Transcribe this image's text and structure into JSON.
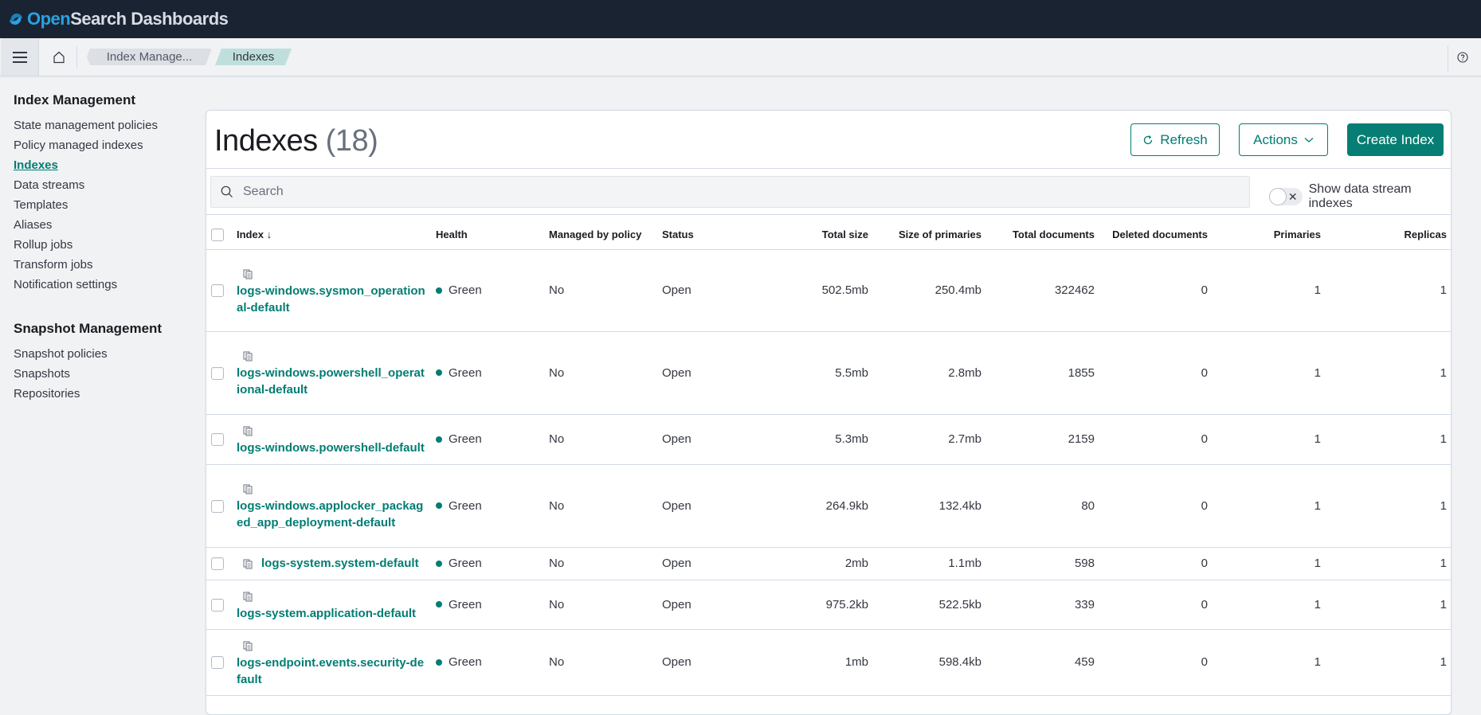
{
  "app": {
    "brand_open": "Open",
    "brand_rest": "Search Dashboards"
  },
  "breadcrumbs": [
    {
      "label": "Index Manage..."
    },
    {
      "label": "Indexes"
    }
  ],
  "sidebar": {
    "sections": [
      {
        "title": "Index Management",
        "items": [
          {
            "label": "State management policies",
            "active": false
          },
          {
            "label": "Policy managed indexes",
            "active": false
          },
          {
            "label": "Indexes",
            "active": true
          },
          {
            "label": "Data streams",
            "active": false
          },
          {
            "label": "Templates",
            "active": false
          },
          {
            "label": "Aliases",
            "active": false
          },
          {
            "label": "Rollup jobs",
            "active": false
          },
          {
            "label": "Transform jobs",
            "active": false
          },
          {
            "label": "Notification settings",
            "active": false
          }
        ]
      },
      {
        "title": "Snapshot Management",
        "items": [
          {
            "label": "Snapshot policies",
            "active": false
          },
          {
            "label": "Snapshots",
            "active": false
          },
          {
            "label": "Repositories",
            "active": false
          }
        ]
      }
    ]
  },
  "main": {
    "title": "Indexes",
    "count": "(18)",
    "buttons": {
      "refresh": "Refresh",
      "actions": "Actions",
      "create": "Create Index"
    },
    "search": {
      "placeholder": "Search",
      "value": ""
    },
    "toggle": {
      "label": "Show data stream indexes",
      "on": false
    },
    "table": {
      "sorted_by": "Index",
      "sort_direction": "descending",
      "columns": [
        "Index",
        "Health",
        "Managed by policy",
        "Status",
        "Total size",
        "Size of primaries",
        "Total documents",
        "Deleted documents",
        "Primaries",
        "Replicas"
      ],
      "rows": [
        {
          "index": "logs-windows.sysmon_operational-default",
          "health": "Green",
          "managed": "No",
          "status": "Open",
          "total_size": "502.5mb",
          "primary_size": "250.4mb",
          "total_docs": "322462",
          "deleted_docs": "0",
          "primaries": "1",
          "replicas": "1"
        },
        {
          "index": "logs-windows.powershell_operational-default",
          "health": "Green",
          "managed": "No",
          "status": "Open",
          "total_size": "5.5mb",
          "primary_size": "2.8mb",
          "total_docs": "1855",
          "deleted_docs": "0",
          "primaries": "1",
          "replicas": "1"
        },
        {
          "index": "logs-windows.powershell-default",
          "health": "Green",
          "managed": "No",
          "status": "Open",
          "total_size": "5.3mb",
          "primary_size": "2.7mb",
          "total_docs": "2159",
          "deleted_docs": "0",
          "primaries": "1",
          "replicas": "1"
        },
        {
          "index": "logs-windows.applocker_packaged_app_deployment-default",
          "health": "Green",
          "managed": "No",
          "status": "Open",
          "total_size": "264.9kb",
          "primary_size": "132.4kb",
          "total_docs": "80",
          "deleted_docs": "0",
          "primaries": "1",
          "replicas": "1"
        },
        {
          "index": "logs-system.system-default",
          "health": "Green",
          "managed": "No",
          "status": "Open",
          "total_size": "2mb",
          "primary_size": "1.1mb",
          "total_docs": "598",
          "deleted_docs": "0",
          "primaries": "1",
          "replicas": "1"
        },
        {
          "index": "logs-system.application-default",
          "health": "Green",
          "managed": "No",
          "status": "Open",
          "total_size": "975.2kb",
          "primary_size": "522.5kb",
          "total_docs": "339",
          "deleted_docs": "0",
          "primaries": "1",
          "replicas": "1"
        },
        {
          "index": "logs-endpoint.events.security-default",
          "health": "Green",
          "managed": "No",
          "status": "Open",
          "total_size": "1mb",
          "primary_size": "598.4kb",
          "total_docs": "459",
          "deleted_docs": "0",
          "primaries": "1",
          "replicas": "1"
        }
      ]
    }
  },
  "colors": {
    "accent": "#017d73",
    "header_bg": "#1a2332",
    "health_green": "#017d73"
  }
}
